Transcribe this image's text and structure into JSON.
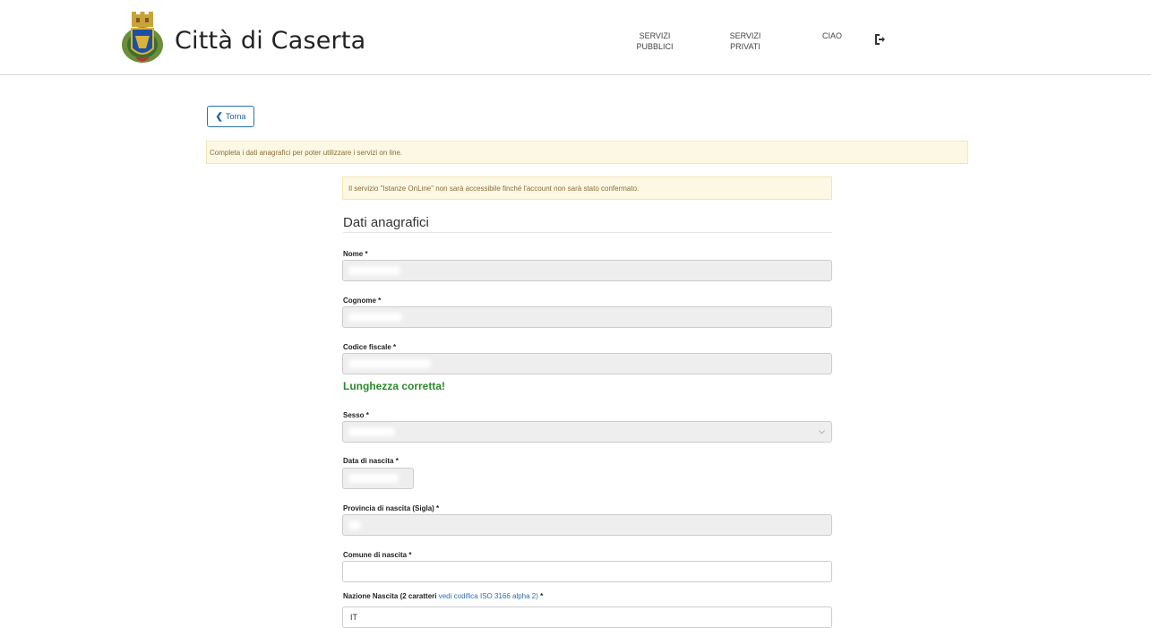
{
  "header": {
    "site_title": "Città di Caserta",
    "nav": [
      {
        "line1": "SERVIZI",
        "line2": "PUBBLICI"
      },
      {
        "line1": "SERVIZI",
        "line2": "PRIVATI"
      },
      {
        "line1": "CIAO",
        "line2": ""
      }
    ],
    "logout_icon": "sign-out-icon"
  },
  "back_button": {
    "label": "Torna",
    "icon": "chevron-left-icon"
  },
  "alerts": {
    "main": "Completa i dati anagrafici per poter utilizzare i servizi on line.",
    "service": "Il servizio \"Istanze OnLine\" non sarà accessibile finché l'account non sarà stato confermato."
  },
  "form": {
    "section_title": "Dati anagrafici",
    "fields": {
      "nome": {
        "label": "Nome *",
        "value": ""
      },
      "cognome": {
        "label": "Cognome *",
        "value": ""
      },
      "codice_fiscale": {
        "label": "Codice fiscale *",
        "value": "",
        "validation": "Lunghezza corretta!"
      },
      "sesso": {
        "label": "Sesso *",
        "value": ""
      },
      "data_nascita": {
        "label": "Data di nascita *",
        "value": ""
      },
      "provincia_nascita": {
        "label": "Provincia di nascita (Sigla) *",
        "value": ""
      },
      "comune_nascita": {
        "label": "Comune di nascita *",
        "value": ""
      },
      "nazione_nascita": {
        "label_prefix": "Nazione Nascita (2 caratteri",
        "label_link": "vedi codifica ISO 3166 alpha 2)",
        "label_suffix": " *",
        "value": "IT"
      }
    }
  },
  "colors": {
    "accent": "#2a6fb7",
    "warning_bg": "#fcf8e3",
    "warning_text": "#8a6d3b",
    "success": "#2b8a2b"
  }
}
